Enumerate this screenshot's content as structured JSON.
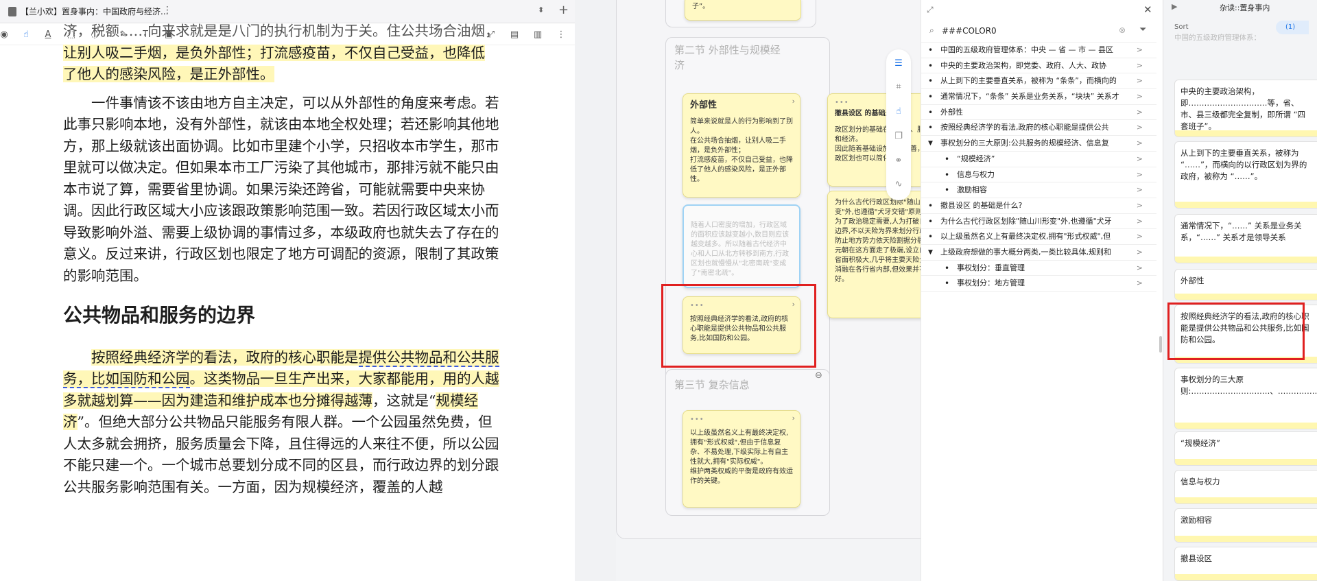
{
  "tab": {
    "title": "【兰小欢】置身事内：中国政府与经济..."
  },
  "reader": {
    "fragment_line": "济，税额……向来求就是是八门的执行机制为于关。住公共场合油烟，",
    "p0_a": "让别人吸二手烟，是负外部性；打流感疫苗，不仅自己受益，也降低",
    "p0_b": "了他人的感染风险，是正外部性。",
    "p1": "一件事情该不该由地方自主决定，可以从外部性的角度来考虑。若此事只影响本地，没有外部性，就该由本地全权处理；若还影响其他地方，那上级就该出面协调。比如市里建个小学，只招收本市学生，那市里就可以做决定。但如果本市工厂污染了其他城市，那排污就不能只由本市说了算，需要省里协调。如果污染还跨省，可能就需要中央来协调。因此行政区域大小应该跟政策影响范围一致。若因行政区域太小而导致影响外溢、需要上级协调的事情过多，本级政府也就失去了存在的意义。反过来讲，行政区划也限定了地方可调配的资源，限制了其政策的影响范围。",
    "heading": "公共物品和服务的边界",
    "p2_hl1": "按照经典经济学的看法，政府的核心职能是",
    "p2_ul1": "提供公共物品和公共服务，比如国防和公园",
    "p2_hl2": "。这类物品一旦生产出来，大家都能用，用的人越多就越划算——因为建造和维护成本也分摊得越薄",
    "p2_mid": "，这就是“",
    "p2_hl3": "规模经济",
    "p2_rest": "”。但绝大部分公共物品只能服务有限人群。一个公园虽然免费，但人太多就会拥挤，服务质量会下降，且住得远的人来往不便，所以公园不能只建一个。一个城市总要划分成不同的区县，而行政边界的划分跟公共服务影响范围有关。一方面，因为规模经济，覆盖的人越"
  },
  "mindmap": {
    "top_card_text": "子”。",
    "section2_title": "第二节 外部性与规模经济",
    "section3_title": "第三节 复杂信息",
    "card_ext_title": "外部性",
    "card_ext_body": "简单来说就是人的行为影响到了别人。\n在公共场合抽烟，让别人吸二手烟，是负外部性；\n打流感疫苗，不仅自己受益，也降低了他人的感染风险，是正外部性。",
    "card_faded_body": "随着人口密度的增加，行政区域的面积应该越变越小,数目则应该越变越多。所以随着古代经济中心和人口从北方转移到南方,行政区划也就慢慢从\"北密南疏\"变成了\"南密北疏\"。",
    "card_pub_body": "按照经典经济学的看法,政府的核心职能是提供公共物品和公共服务,比如国防和公园。",
    "card_county_title": "撤县设区 的基础是什么?",
    "card_county_body": "政区划分的基础在于税收、服务和经济。\n因此随着基础设施不断改善，行政区划也可以简化",
    "card_ancient_body": "为什么古代行政区划除\"随山川形变\"外,也遵循\"犬牙交错\"原则?\n为了政治稳定需要,人为打破自然边界,不以天险为界来划分行政区,防止地方势力依天险割据分裂。\n元朝在这方面走了极端,设立的行省面积极大,几乎将主要天险全部消融在各行省内部,但效果并不好。",
    "card_info_body": "以上级虽然名义上有最终决定权,拥有\"形式权威\",但由于信息复杂、不易处理,下级实际上有自主性就大,拥有\"实际权威\"。\n维护两类权威的平衡是政府有效运作的关键。",
    "dots": "•••"
  },
  "outline": {
    "header_title": "杂读::置身事内",
    "search_value": "###COLOR0",
    "items": [
      "中国的五级政府管理体系：中央 — 省 — 市 — 县区",
      "中央的主要政治架构，即党委、政府、人大、政协",
      "从上到下的主要垂直关系，被称为 “条条”，而横向的",
      "通常情况下，“条条” 关系是业务关系，“块块” 关系才",
      "外部性",
      "按照经典经济学的看法,政府的核心职能是提供公共",
      "事权划分的三大原则:公共服务的规模经济、信息复",
      "“规模经济”",
      "信息与权力",
      "激励相容",
      "撤县设区 的基础是什么?",
      "为什么古代行政区划除\"随山川形变\"外,也遵循\"犬牙",
      "以上级虽然名义上有最终决定权,拥有\"形式权威\",但",
      "上级政府想做的事大概分两类,一类比较具体,规则和",
      "事权划分：垂直管理",
      "事权划分：地方管理"
    ]
  },
  "cards_panel": {
    "sort_label": "Sort",
    "count_label": "(1)",
    "top_partial": "中国的五级政府管理体系：",
    "cards": [
      "中央的主要政治架构，即…………………………等，省、市、县三级都完全复制，即所谓 “四套班子”。",
      "从上到下的主要垂直关系，被称为 “……”，而横向的以行政区划为界的政府，被称为 “……”。",
      "通常情况下，“……” 关系是业务关系，“……” 关系才是领导关系",
      "外部性",
      "按照经典经济学的看法,政府的核心职能是提供公共物品和公共服务,比如国防和公园。",
      "事权划分的三大原则:…………………………、……………、…………。",
      "“规模经济”",
      "信息与权力",
      "激励相容",
      "撤县设区"
    ]
  }
}
